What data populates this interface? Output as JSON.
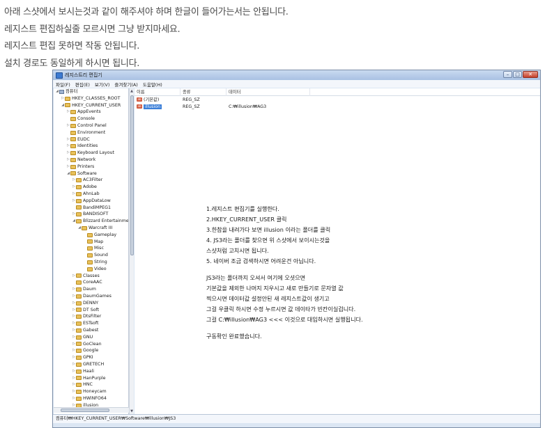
{
  "intro": [
    "아래 스샷에서 보시는것과 같이 해주셔야 하며 한글이 들어가는서는 안됩니다.",
    "레지스트 편집하실줄 모르시면 그냥 받지마세요.",
    "레지스트 편집 못하면 작동 안됩니다.",
    "설치 경로도 동일하게 하시면 됩니다."
  ],
  "window": {
    "title": "레지스트리 편집기",
    "buttons": {
      "minimize": "–",
      "maximize": "□",
      "close": "✕"
    }
  },
  "menu": [
    "파일(F)",
    "편집(E)",
    "보기(V)",
    "즐겨찾기(A)",
    "도움말(H)"
  ],
  "tree": {
    "root": "컴퓨터",
    "nodes": [
      "HKEY_CLASSES_ROOT",
      "HKEY_CURRENT_USER",
      "AppEvents",
      "Console",
      "Control Panel",
      "Environment",
      "EUDC",
      "Identities",
      "Keyboard Layout",
      "Network",
      "Printers",
      "Software",
      "AC3Filter",
      "Adobe",
      "AhnLab",
      "AppDataLow",
      "BandiMPEG1",
      "BANDISOFT",
      "Blizzard Entertainment",
      "Warcraft III",
      "Gameplay",
      "Map",
      "Misc",
      "Sound",
      "String",
      "Video",
      "Classes",
      "CoreAAC",
      "Daum",
      "DaumGames",
      "DENNY",
      "DT Soft",
      "DtsFilter",
      "ESTsoft",
      "Gabest",
      "GNU",
      "GoClean",
      "Google",
      "GPKI",
      "GRETECH",
      "Haali",
      "HanPurple",
      "HNC",
      "Honeycam",
      "HWiNFO64",
      "illusion"
    ]
  },
  "list": {
    "columns": [
      "이름",
      "종류",
      "데이터"
    ],
    "rows": [
      {
        "name": "(기본값)",
        "type": "REG_SZ",
        "data": ""
      },
      {
        "name": "illusion",
        "type": "REG_SZ",
        "data": "C:₩illusion₩AG3"
      }
    ]
  },
  "notes": [
    "1.레지스트 편집기를 실행한다.",
    "2.HKEY_CURRENT_USER  클릭",
    "3.한참을 내려가다 보면 illusion 이라는 폴더를 클릭",
    "4. JS3라는 폴더를 찾으면 위 스샷에서 보이시는것을",
    "스샷처럼 고치시면 됩니다.",
    "5. 네이버 조금 검색하시면 어려운건 아닙니다.",
    "JS3라는 폴더까지 오셔서 여기에 오셧으면",
    "기본값을 제외한 나머지 지우시고 새로 만들기로 문자열 값",
    "찍으시면 데이터값 설정안된 새 레지스트값이 생기고",
    "그걸 우클릭 하시면 수정 누르시면 값 데이타가 빈칸이실겁니다.",
    "그걸 C:₩illusion₩AG3 <<< 이것으로 대입하시면 실행됩니다.",
    "구동확인 완료했습니다."
  ],
  "statusbar": "컴퓨터₩HKEY_CURRENT_USER₩Software₩illusion₩JS3"
}
